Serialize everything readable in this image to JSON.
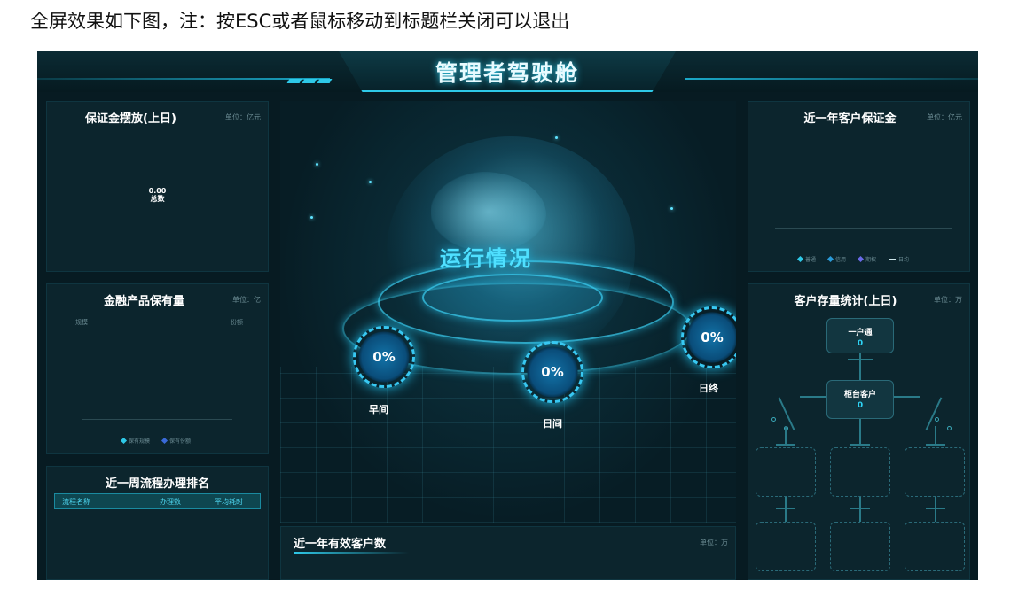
{
  "caption": "全屏效果如下图，注：按ESC或者鼠标移动到标题栏关闭可以退出",
  "dashboard": {
    "title": "管理者驾驶舱"
  },
  "left_top": {
    "title": "保证金摆放(上日)",
    "unit": "单位：亿元",
    "value": "0.00",
    "value_label": "总数"
  },
  "left_mid": {
    "title": "金融产品保有量",
    "unit": "单位：亿",
    "axis_left": "规模",
    "axis_right": "份额",
    "legend": [
      "保有规模",
      "保有份额"
    ]
  },
  "left_bottom": {
    "title": "近一周流程办理排名",
    "columns": [
      "流程名称",
      "办理数",
      "平均耗时"
    ]
  },
  "center": {
    "run_label": "运行情况",
    "gauges": [
      {
        "label": "早间",
        "value": "0%"
      },
      {
        "label": "日间",
        "value": "0%"
      },
      {
        "label": "日终",
        "value": "0%"
      }
    ]
  },
  "center_bottom": {
    "title": "近一年有效客户数",
    "unit": "单位：万"
  },
  "right_top": {
    "title": "近一年客户保证金",
    "unit": "单位：亿元",
    "legend": [
      "普通",
      "信用",
      "期权",
      "日均"
    ]
  },
  "right_bottom": {
    "title": "客户存量统计(上日)",
    "unit": "单位：万",
    "node1": {
      "label": "一户通",
      "value": "0"
    },
    "node2": {
      "label": "柜台客户",
      "value": "0"
    }
  },
  "colors": {
    "accent": "#2ec9e8",
    "panel_bg": "#0c252d",
    "screen_bg": "#071b22"
  }
}
